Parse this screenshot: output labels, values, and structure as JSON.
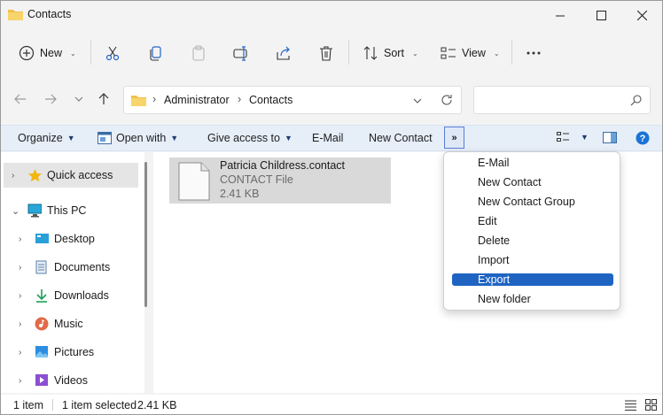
{
  "window": {
    "title": "Contacts"
  },
  "commandbar": {
    "new_label": "New",
    "sort_label": "Sort",
    "view_label": "View"
  },
  "address": {
    "segments": [
      "Administrator",
      "Contacts"
    ],
    "search_placeholder": ""
  },
  "legacy_toolbar": {
    "items": [
      "Organize",
      "Open with",
      "Give access to",
      "E-Mail",
      "New Contact"
    ],
    "overflow_label": "»"
  },
  "nav": {
    "items": [
      {
        "label": "Quick access",
        "icon": "star-icon"
      },
      {
        "label": "This PC",
        "icon": "monitor-icon"
      },
      {
        "label": "Desktop",
        "icon": "desktop-icon"
      },
      {
        "label": "Documents",
        "icon": "documents-icon"
      },
      {
        "label": "Downloads",
        "icon": "downloads-icon"
      },
      {
        "label": "Music",
        "icon": "music-icon"
      },
      {
        "label": "Pictures",
        "icon": "pictures-icon"
      },
      {
        "label": "Videos",
        "icon": "videos-icon"
      }
    ]
  },
  "file": {
    "name": "Patricia  Childress.contact",
    "type": "CONTACT File",
    "size": "2.41 KB"
  },
  "menu": {
    "items": [
      "E-Mail",
      "New Contact",
      "New Contact Group",
      "Edit",
      "Delete",
      "Import",
      "Export",
      "New folder"
    ],
    "highlighted": "Export"
  },
  "status": {
    "item_count": "1 item",
    "selected": "1 item selected",
    "selected_size": "2.41 KB"
  },
  "colors": {
    "accent": "#1f64c2",
    "folder": "#f2c04a",
    "help": "#1a73d6"
  }
}
